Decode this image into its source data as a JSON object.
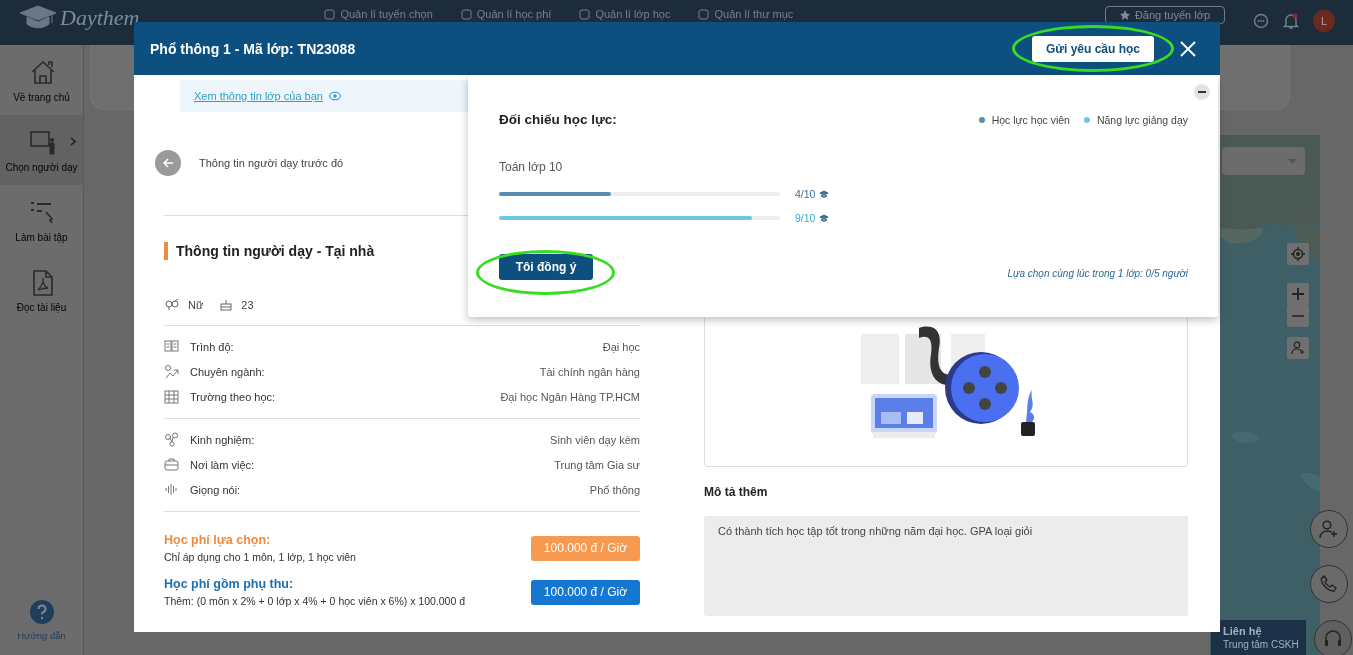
{
  "app_bar": {
    "logo": "Daythem",
    "nav": [
      "Quản lí tuyển chọn",
      "Quản lí học phí",
      "Quản lí lớp học",
      "Quản lí thư mục"
    ],
    "post_button": "Đăng tuyển lớp",
    "avatar": "L"
  },
  "sidebar": {
    "items": [
      {
        "label": "Về trang chủ",
        "selected": false
      },
      {
        "label": "Chọn người dạy",
        "selected": true
      },
      {
        "label": "Làm bài tập",
        "selected": false
      },
      {
        "label": "Đọc tài liệu",
        "selected": false
      }
    ],
    "help": "Hướng dẫn"
  },
  "contact": {
    "title": "Liên hệ",
    "subtitle": "Trung tâm CSKH"
  },
  "modal": {
    "title": "Phổ thông 1 - Mã lớp: TN23088",
    "request_button": "Gửi yêu cầu học",
    "class_link": "Xem thông tin lớp của bạn",
    "back_label": "Thông tin người dạy trước đó",
    "section_title": "Thông tin người dạy - Tại nhà",
    "gender": "Nữ",
    "age": "23",
    "detail_groups": [
      {
        "rows": [
          {
            "label": "Trình độ:",
            "value": "Đại học"
          },
          {
            "label": "Chuyên ngành:",
            "value": "Tài chính ngân hàng"
          },
          {
            "label": "Trường theo học:",
            "value": "Đại học Ngân Hàng TP.HCM"
          }
        ]
      },
      {
        "rows": [
          {
            "label": "Kinh nghiệm:",
            "value": "Sinh viên dạy kèm"
          },
          {
            "label": "Nơi làm việc:",
            "value": "Trung tâm Gia sư"
          },
          {
            "label": "Giọng nói:",
            "value": "Phổ thông"
          }
        ]
      }
    ],
    "fees": [
      {
        "kind": "choice",
        "title": "Học phí lựa chọn:",
        "note": "Chỉ áp dụng cho 1 môn, 1 lớp, 1 học viên",
        "price": "100.000 đ / Giờ"
      },
      {
        "kind": "surcharge",
        "title": "Học phí gồm phụ thu:",
        "note": "Thêm: (0 môn x 2% + 0 lớp x 4% + 0 học viên x 6%) x 100.000 đ",
        "price": "100.000 đ / Giờ"
      }
    ],
    "description_title": "Mô tả thêm",
    "description": "Có thành tích học tập tốt trong những năm đại học. GPA loại giỏi"
  },
  "comparison": {
    "title": "Đối chiếu học lực:",
    "legend": [
      {
        "label": "Học lực học viên",
        "color": "#5b8db0"
      },
      {
        "label": "Năng lực giảng dạy",
        "color": "#6ec6e3"
      }
    ],
    "subject": "Toán lớp 10",
    "bars": [
      {
        "level": 0.4,
        "reading": "4/10",
        "color": "#5b8db0"
      },
      {
        "level": 0.9,
        "reading": "9/10",
        "color": "#6ec6e3"
      }
    ],
    "agree_button": "Tôi đồng ý",
    "note": "Lựa chọn cùng lúc trong 1 lớp: 0/5 người"
  }
}
